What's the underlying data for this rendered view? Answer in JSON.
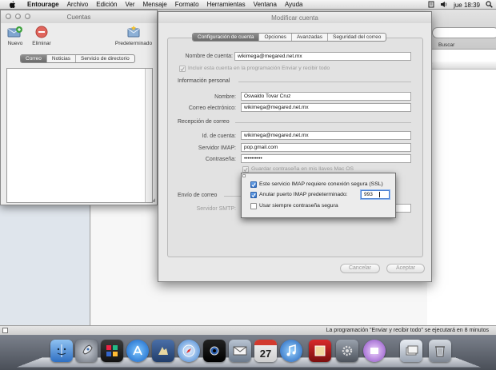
{
  "menubar": {
    "app_name": "Entourage",
    "items": [
      "Archivo",
      "Edición",
      "Ver",
      "Mensaje",
      "Formato",
      "Herramientas",
      "Ventana",
      "Ayuda"
    ],
    "clock": "jue 18:39"
  },
  "main_window": {
    "search_label": "Buscar",
    "status_text": "La programación \"Enviar y recibir todo\" se ejecutará en 8 minutos"
  },
  "cuentas": {
    "title": "Cuentas",
    "toolbar": {
      "new": "Nuevo",
      "delete": "Eliminar",
      "default": "Predeterminado"
    },
    "tabs": [
      {
        "label": "Correo",
        "selected": true
      },
      {
        "label": "Noticias",
        "selected": false
      },
      {
        "label": "Servicio de directorio",
        "selected": false
      }
    ]
  },
  "dialog": {
    "title": "Modificar cuenta",
    "tabs": [
      {
        "label": "Configuración de cuenta",
        "selected": true
      },
      {
        "label": "Opciones",
        "selected": false
      },
      {
        "label": "Avanzadas",
        "selected": false
      },
      {
        "label": "Seguridad del correo",
        "selected": false
      }
    ],
    "account_name_label": "Nombre de cuenta:",
    "account_name_value": "wikimega@megared.net.mx",
    "include_label": "Incluir esta cuenta en la programación Enviar y recibir todo",
    "personal_header": "Información personal",
    "name_label": "Nombre:",
    "name_value": "Oswaldo Tovar Cruz",
    "email_label": "Correo electrónico:",
    "email_value": "wikimega@megared.net.mx",
    "receiving_header": "Recepción de correo",
    "account_id_label": "Id. de cuenta:",
    "account_id_value": "wikimega@megared.net.mx",
    "imap_label": "Servidor IMAP:",
    "imap_value": "pop.gmail.com",
    "password_label": "Contraseña:",
    "password_value": "••••••••••",
    "keychain_label": "Guardar contraseña en mis llaves Mac OS",
    "sending_header": "Envío de correo",
    "smtp_label": "Servidor SMTP:",
    "cancel": "Cancelar",
    "accept": "Aceptar"
  },
  "popover": {
    "ssl_label": "Este servicio IMAP requiere conexión segura (SSL)",
    "ssl_checked": true,
    "override_port_label": "Anular puerto IMAP predeterminado:",
    "override_port_checked": true,
    "port_value": "993",
    "always_secure_label": "Usar siempre contraseña segura",
    "always_secure_checked": false
  },
  "dock": {
    "icons": [
      "finder-icon",
      "rocket-icon",
      "dashboard-icon",
      "app-store-icon",
      "preview-icon",
      "safari-icon",
      "photo-booth-icon",
      "mail-icon",
      "address-book-icon",
      "ical-icon",
      "itunes-icon",
      "photo-icon",
      "system-preferences-icon",
      "iphoto-icon",
      "downloads-stack-icon",
      "trash-icon"
    ],
    "ical_day": "27"
  }
}
